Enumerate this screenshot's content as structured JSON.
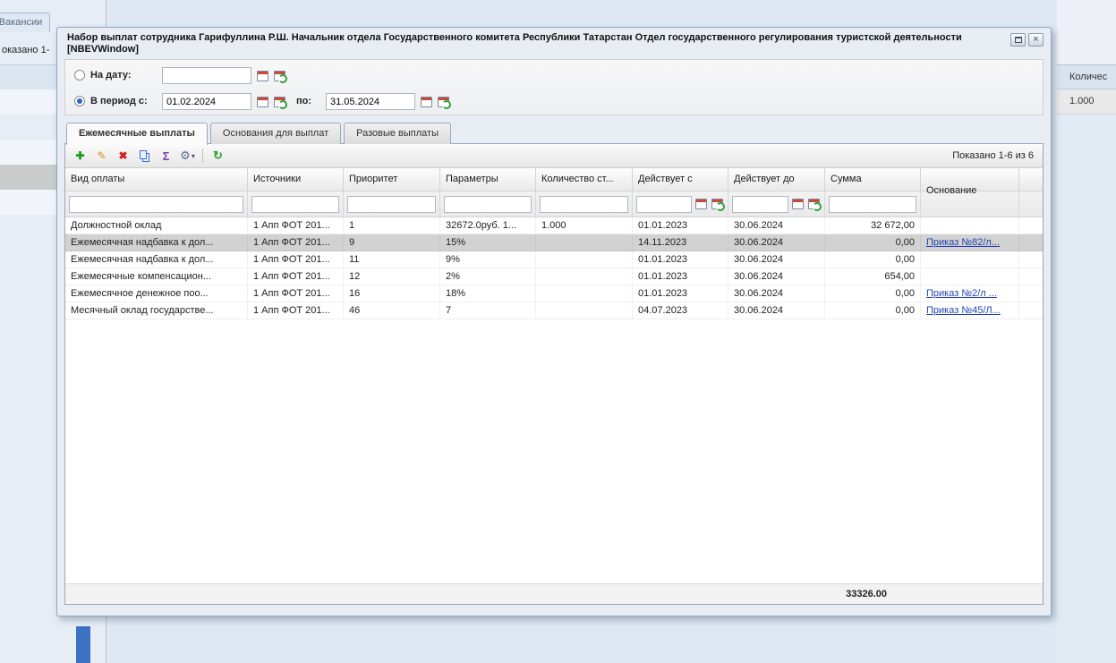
{
  "background": {
    "tab_label": "Вакансии",
    "left_partial_text": "оказано 1-",
    "right_column_header": "Количес",
    "right_cell_value": "1.000"
  },
  "window": {
    "title": "Набор выплат сотрудника Гарифуллина Р.Ш. Начальник отдела Государственного комитета Республики Татарстан Отдел государственного регулирования туристской деятельности [NBEVWindow]",
    "controls": {
      "close_glyph": "×"
    },
    "filters": {
      "on_date_label": "На дату:",
      "on_date_value": "",
      "period_label": "В период с:",
      "period_from": "01.02.2024",
      "to_label": "по:",
      "period_to": "31.05.2024"
    },
    "tabs": [
      "Ежемесячные выплаты",
      "Основания для выплат",
      "Разовые выплаты"
    ],
    "toolbar": {
      "icons": {
        "add": "✚",
        "edit": "✎",
        "delete": "✖",
        "sum": "Σ",
        "gear": "⚙",
        "dropdown": "▾",
        "refresh": "↻"
      },
      "paging": "Показано 1-6 из 6"
    },
    "grid": {
      "columns": [
        "Вид оплаты",
        "Источники",
        "Приоритет",
        "Параметры",
        "Количество ст...",
        "Действует с",
        "Действует до",
        "Сумма",
        "Основание"
      ],
      "rows": [
        {
          "cells": [
            "Должностной оклад",
            "1 Апп ФОТ 201...",
            "1",
            "32672.0руб. 1...",
            "1.000",
            "01.01.2023",
            "30.06.2024",
            "32 672,00",
            ""
          ]
        },
        {
          "cells": [
            "Ежемесячная надбавка к дол...",
            "1 Апп ФОТ 201...",
            "9",
            "15%",
            "",
            "14.11.2023",
            "30.06.2024",
            "0,00",
            "Приказ №82/л..."
          ]
        },
        {
          "cells": [
            "Ежемесячная надбавка к дол...",
            "1 Апп ФОТ 201...",
            "11",
            "9%",
            "",
            "01.01.2023",
            "30.06.2024",
            "0,00",
            ""
          ]
        },
        {
          "cells": [
            "Ежемесячные компенсацион...",
            "1 Апп ФОТ 201...",
            "12",
            "2%",
            "",
            "01.01.2023",
            "30.06.2024",
            "654,00",
            ""
          ]
        },
        {
          "cells": [
            "Ежемесячное денежное поо...",
            "1 Апп ФОТ 201...",
            "16",
            "18%",
            "",
            "01.01.2023",
            "30.06.2024",
            "0,00",
            "Приказ №2/л ..."
          ]
        },
        {
          "cells": [
            "Месячный оклад государстве...",
            "1 Апп ФОТ 201...",
            "46",
            "7",
            "",
            "04.07.2023",
            "30.06.2024",
            "0,00",
            "Приказ №45/Л..."
          ]
        }
      ],
      "total": "33326.00"
    }
  }
}
